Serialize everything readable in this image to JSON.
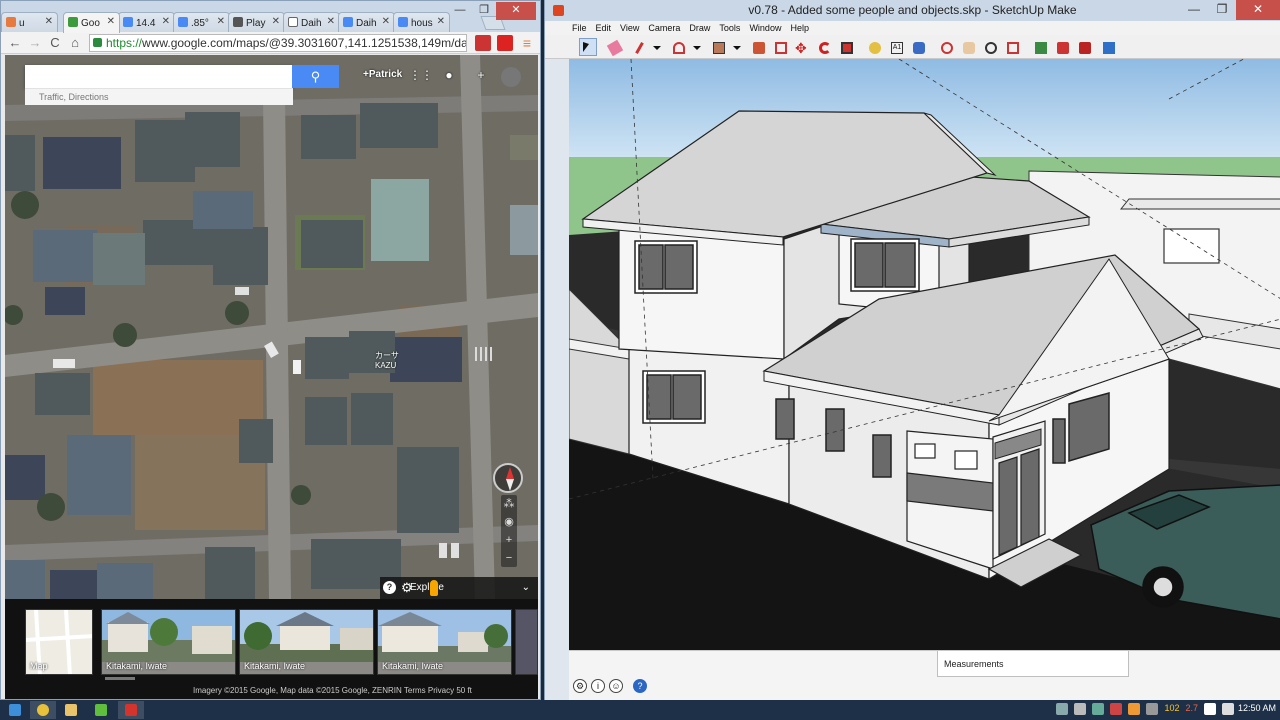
{
  "chrome": {
    "tabs": [
      {
        "label": "u",
        "color": "#e77a3e"
      },
      {
        "label": "Goo",
        "color": "#3c9c3c",
        "active": true
      },
      {
        "label": "14.4",
        "color": "#4a8af4"
      },
      {
        "label": ".85°",
        "color": "#4a8af4"
      },
      {
        "label": "Play",
        "color": "#555555"
      },
      {
        "label": "Daih",
        "color": "#555555"
      },
      {
        "label": "Daih",
        "color": "#4a8af4"
      },
      {
        "label": "hous",
        "color": "#4a8af4"
      }
    ],
    "url_scheme": "https://",
    "url_rest": "www.google.com/maps/@39.3031607,141.1251538,149m/data=!3m",
    "win_minimize": "—",
    "win_maximize": "❐",
    "win_close": "✕",
    "back": "←",
    "forward": "→",
    "reload": "C",
    "home": "⌂",
    "menu": "≡"
  },
  "map": {
    "search_placeholder": "",
    "search_icon": "search-icon",
    "search_btn_glyph": "⚲",
    "sub_text": "Traffic, Directions",
    "user": "+Patrick",
    "label_kasa": "カーサ",
    "label_kazu": "KAZU",
    "explore": "Explore",
    "explore_chevron": "⌄",
    "footer": "Imagery ©2015 Google, Map data ©2015 Google, ZENRIN    Terms    Privacy    50 ft",
    "thumbs": [
      {
        "caption": "Map"
      },
      {
        "caption": "Kitakami, Iwate"
      },
      {
        "caption": "Kitakami, Iwate"
      },
      {
        "caption": "Kitakami, Iwate"
      }
    ]
  },
  "sketchup": {
    "title": "v0.78 - Added some people and objects.skp - SketchUp Make",
    "menu": [
      "File",
      "Edit",
      "View",
      "Camera",
      "Draw",
      "Tools",
      "Window",
      "Help"
    ],
    "measurements_label": "Measurements",
    "status_icons": [
      "⚙",
      "i",
      "☺",
      "?"
    ],
    "win_minimize": "—",
    "win_maximize": "❐",
    "win_close": "✕"
  },
  "taskbar": {
    "tray_text": "102",
    "tray_text2": "2.7",
    "clock": "12:50 AM"
  },
  "colors": {
    "sky": "#9cc3e6",
    "grass": "#8fc58a",
    "road": "#1e1e1e",
    "accent_blue": "#4a8af4"
  }
}
